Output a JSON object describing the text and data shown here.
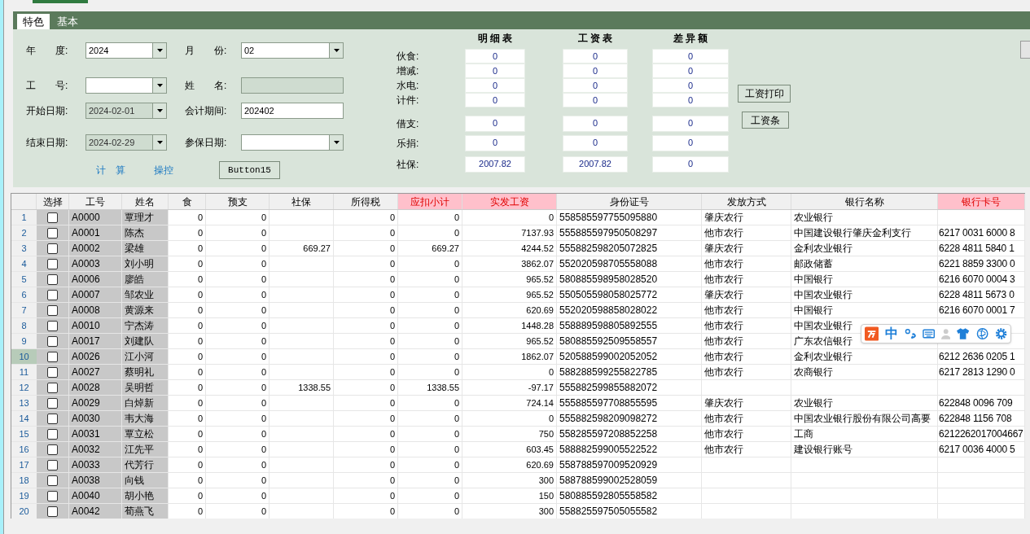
{
  "tabs": [
    {
      "label": "特色",
      "selected": true
    },
    {
      "label": "基本",
      "selected": false
    }
  ],
  "form": [
    {
      "label": "年　　度:",
      "value": "2024",
      "dropdown": true,
      "disabled": false,
      "label2": "月　　份:",
      "value2": "02",
      "dropdown2": true,
      "disabled2": false
    },
    {
      "label": "工　　号:",
      "dropdown": true,
      "disabled": false,
      "label2": "姓　　名:",
      "dropdown2": false,
      "disabled2": true
    },
    {
      "label": "开始日期:",
      "value": "2024-02-01",
      "dropdown": true,
      "disabled": true,
      "label2": "会计期间:",
      "value2": "202402",
      "dropdown2": false,
      "disabled2": false
    },
    {
      "label": "结束日期:",
      "value": "2024-02-29",
      "dropdown": true,
      "disabled": true,
      "label2": "参保日期:",
      "dropdown2": true,
      "disabled2": false
    }
  ],
  "links": [
    "计　算",
    "操控"
  ],
  "button15": "Button15",
  "compare": {
    "headers": [
      "明 细 表",
      "工 资 表",
      "差 异 额"
    ],
    "rows": [
      {
        "label": "伙食:",
        "values": [
          "0",
          "0",
          "0"
        ]
      },
      {
        "label": "增减:",
        "values": [
          "0",
          "0",
          "0"
        ]
      },
      {
        "label": "水电:",
        "values": [
          "0",
          "0",
          "0"
        ]
      },
      {
        "label": "计件:",
        "values": [
          "0",
          "0",
          "0"
        ]
      },
      {
        "label": "借支:",
        "values": [
          "0",
          "0",
          "0"
        ]
      },
      {
        "label": "乐捐:",
        "values": [
          "0",
          "0",
          "0"
        ]
      },
      {
        "label": "社保:",
        "values": [
          "2007.82",
          "2007.82",
          "0"
        ]
      }
    ]
  },
  "print_buttons": [
    "工资打印",
    "工资条"
  ],
  "table": {
    "columns": [
      {
        "label": "选择",
        "kind": "check",
        "highlight": false
      },
      {
        "label": "工号",
        "kind": "code",
        "highlight": false
      },
      {
        "label": "姓名",
        "kind": "name",
        "highlight": false
      },
      {
        "label": "食",
        "kind": "number",
        "highlight": false
      },
      {
        "label": "预支",
        "kind": "number",
        "highlight": false
      },
      {
        "label": "社保",
        "kind": "number",
        "highlight": false
      },
      {
        "label": "所得税",
        "kind": "number",
        "highlight": false
      },
      {
        "label": "应扣小计",
        "kind": "number",
        "highlight": true
      },
      {
        "label": "实发工资",
        "kind": "number",
        "highlight": true
      },
      {
        "label": "身份证号",
        "kind": "text",
        "highlight": false
      },
      {
        "label": "发放方式",
        "kind": "text",
        "highlight": false
      },
      {
        "label": "银行名称",
        "kind": "text",
        "highlight": false
      },
      {
        "label": "银行卡号",
        "kind": "text",
        "highlight": true
      }
    ],
    "rows": [
      {
        "no": "1",
        "selected": false,
        "checked": false,
        "cells": [
          null,
          "A0000",
          "覃理才",
          "0",
          "0",
          null,
          "0",
          "0",
          "0",
          "558585597755095880",
          "肇庆农行",
          "农业银行",
          null
        ]
      },
      {
        "no": "2",
        "selected": false,
        "checked": false,
        "cells": [
          null,
          "A0001",
          "陈杰",
          "0",
          "0",
          null,
          "0",
          "0",
          "7137.93",
          "555885597950508297",
          "他市农行",
          "中国建设银行肇庆金利支行",
          "6217 0031 6000 8"
        ]
      },
      {
        "no": "3",
        "selected": false,
        "checked": false,
        "cells": [
          null,
          "A0002",
          "梁雄",
          "0",
          "0",
          "669.27",
          "0",
          "669.27",
          "4244.52",
          "555882598205072825",
          "肇庆农行",
          "金利农业银行",
          "6228 4811 5840 1"
        ]
      },
      {
        "no": "4",
        "selected": false,
        "checked": false,
        "cells": [
          null,
          "A0003",
          "刘小明",
          "0",
          "0",
          null,
          "0",
          "0",
          "3862.07",
          "552020598705558088",
          "他市农行",
          "邮政储蓄",
          "6221 8859 3300 0"
        ]
      },
      {
        "no": "5",
        "selected": false,
        "checked": false,
        "cells": [
          null,
          "A0006",
          "廖皓",
          "0",
          "0",
          null,
          "0",
          "0",
          "965.52",
          "580885598958028520",
          "他市农行",
          "中国银行",
          "6216 6070 0004 3"
        ]
      },
      {
        "no": "6",
        "selected": false,
        "checked": false,
        "cells": [
          null,
          "A0007",
          "邹农业",
          "0",
          "0",
          null,
          "0",
          "0",
          "965.52",
          "550505598058025772",
          "肇庆农行",
          "中国农业银行",
          "6228 4811 5673 0"
        ]
      },
      {
        "no": "7",
        "selected": false,
        "checked": false,
        "cells": [
          null,
          "A0008",
          "黄源来",
          "0",
          "0",
          null,
          "0",
          "0",
          "620.69",
          "552020598858028022",
          "他市农行",
          "中国银行",
          "6216 6070 0001 7"
        ]
      },
      {
        "no": "8",
        "selected": false,
        "checked": false,
        "cells": [
          null,
          "A0010",
          "宁杰涛",
          "0",
          "0",
          null,
          "0",
          "0",
          "1448.28",
          "558889598805892555",
          "他市农行",
          "中国农业银行",
          null
        ]
      },
      {
        "no": "9",
        "selected": false,
        "checked": false,
        "cells": [
          null,
          "A0017",
          "刘建队",
          "0",
          "0",
          null,
          "0",
          "0",
          "965.52",
          "580885592509558557",
          "他市农行",
          "广东农信银行",
          null
        ]
      },
      {
        "no": "10",
        "selected": true,
        "checked": false,
        "cells": [
          null,
          "A0026",
          "江小河",
          "0",
          "0",
          null,
          "0",
          "0",
          "1862.07",
          "520588599002052052",
          "他市农行",
          "金利农业银行",
          "6212 2636 0205 1"
        ]
      },
      {
        "no": "11",
        "selected": false,
        "checked": false,
        "cells": [
          null,
          "A0027",
          "蔡明礼",
          "0",
          "0",
          null,
          "0",
          "0",
          "0",
          "588288599255822785",
          "他市农行",
          "农商银行",
          "6217 2813 1290 0"
        ]
      },
      {
        "no": "12",
        "selected": false,
        "checked": false,
        "cells": [
          null,
          "A0028",
          "吴明哲",
          "0",
          "0",
          "1338.55",
          "0",
          "1338.55",
          "-97.17",
          "555882599855882072",
          null,
          null,
          null
        ]
      },
      {
        "no": "13",
        "selected": false,
        "checked": false,
        "cells": [
          null,
          "A0029",
          "白焯新",
          "0",
          "0",
          null,
          "0",
          "0",
          "724.14",
          "555885597708855595",
          "肇庆农行",
          "农业银行",
          "622848 0096 709"
        ]
      },
      {
        "no": "14",
        "selected": false,
        "checked": false,
        "cells": [
          null,
          "A0030",
          "韦大海",
          "0",
          "0",
          null,
          "0",
          "0",
          "0",
          "555882598209098272",
          "他市农行",
          "中国农业银行股份有限公司高要",
          "622848 1156 708"
        ]
      },
      {
        "no": "15",
        "selected": false,
        "checked": false,
        "cells": [
          null,
          "A0031",
          "覃立松",
          "0",
          "0",
          null,
          "0",
          "0",
          "750",
          "558285597208852258",
          "他市农行",
          "工商",
          "6212262017004667"
        ]
      },
      {
        "no": "16",
        "selected": false,
        "checked": false,
        "cells": [
          null,
          "A0032",
          "江先平",
          "0",
          "0",
          null,
          "0",
          "0",
          "603.45",
          "588882599005522522",
          "他市农行",
          "建设银行账号",
          "6217 0036 4000 5"
        ]
      },
      {
        "no": "17",
        "selected": false,
        "checked": false,
        "cells": [
          null,
          "A0033",
          "代芳行",
          "0",
          "0",
          null,
          "0",
          "0",
          "620.69",
          "558788597009520929",
          null,
          null,
          null
        ]
      },
      {
        "no": "18",
        "selected": false,
        "checked": false,
        "cells": [
          null,
          "A0038",
          "向钱",
          "0",
          "0",
          null,
          "0",
          "0",
          "300",
          "588788599002528059",
          null,
          null,
          null
        ]
      },
      {
        "no": "19",
        "selected": false,
        "checked": false,
        "cells": [
          null,
          "A0040",
          "胡小艳",
          "0",
          "0",
          null,
          "0",
          "0",
          "150",
          "580885592805558582",
          null,
          null,
          null
        ]
      },
      {
        "no": "20",
        "selected": false,
        "checked": false,
        "cells": [
          null,
          "A0042",
          "荀燕飞",
          "0",
          "0",
          null,
          "0",
          "0",
          "300",
          "558825597505055582",
          null,
          null,
          null
        ]
      }
    ]
  },
  "ime": {
    "label": "中"
  }
}
